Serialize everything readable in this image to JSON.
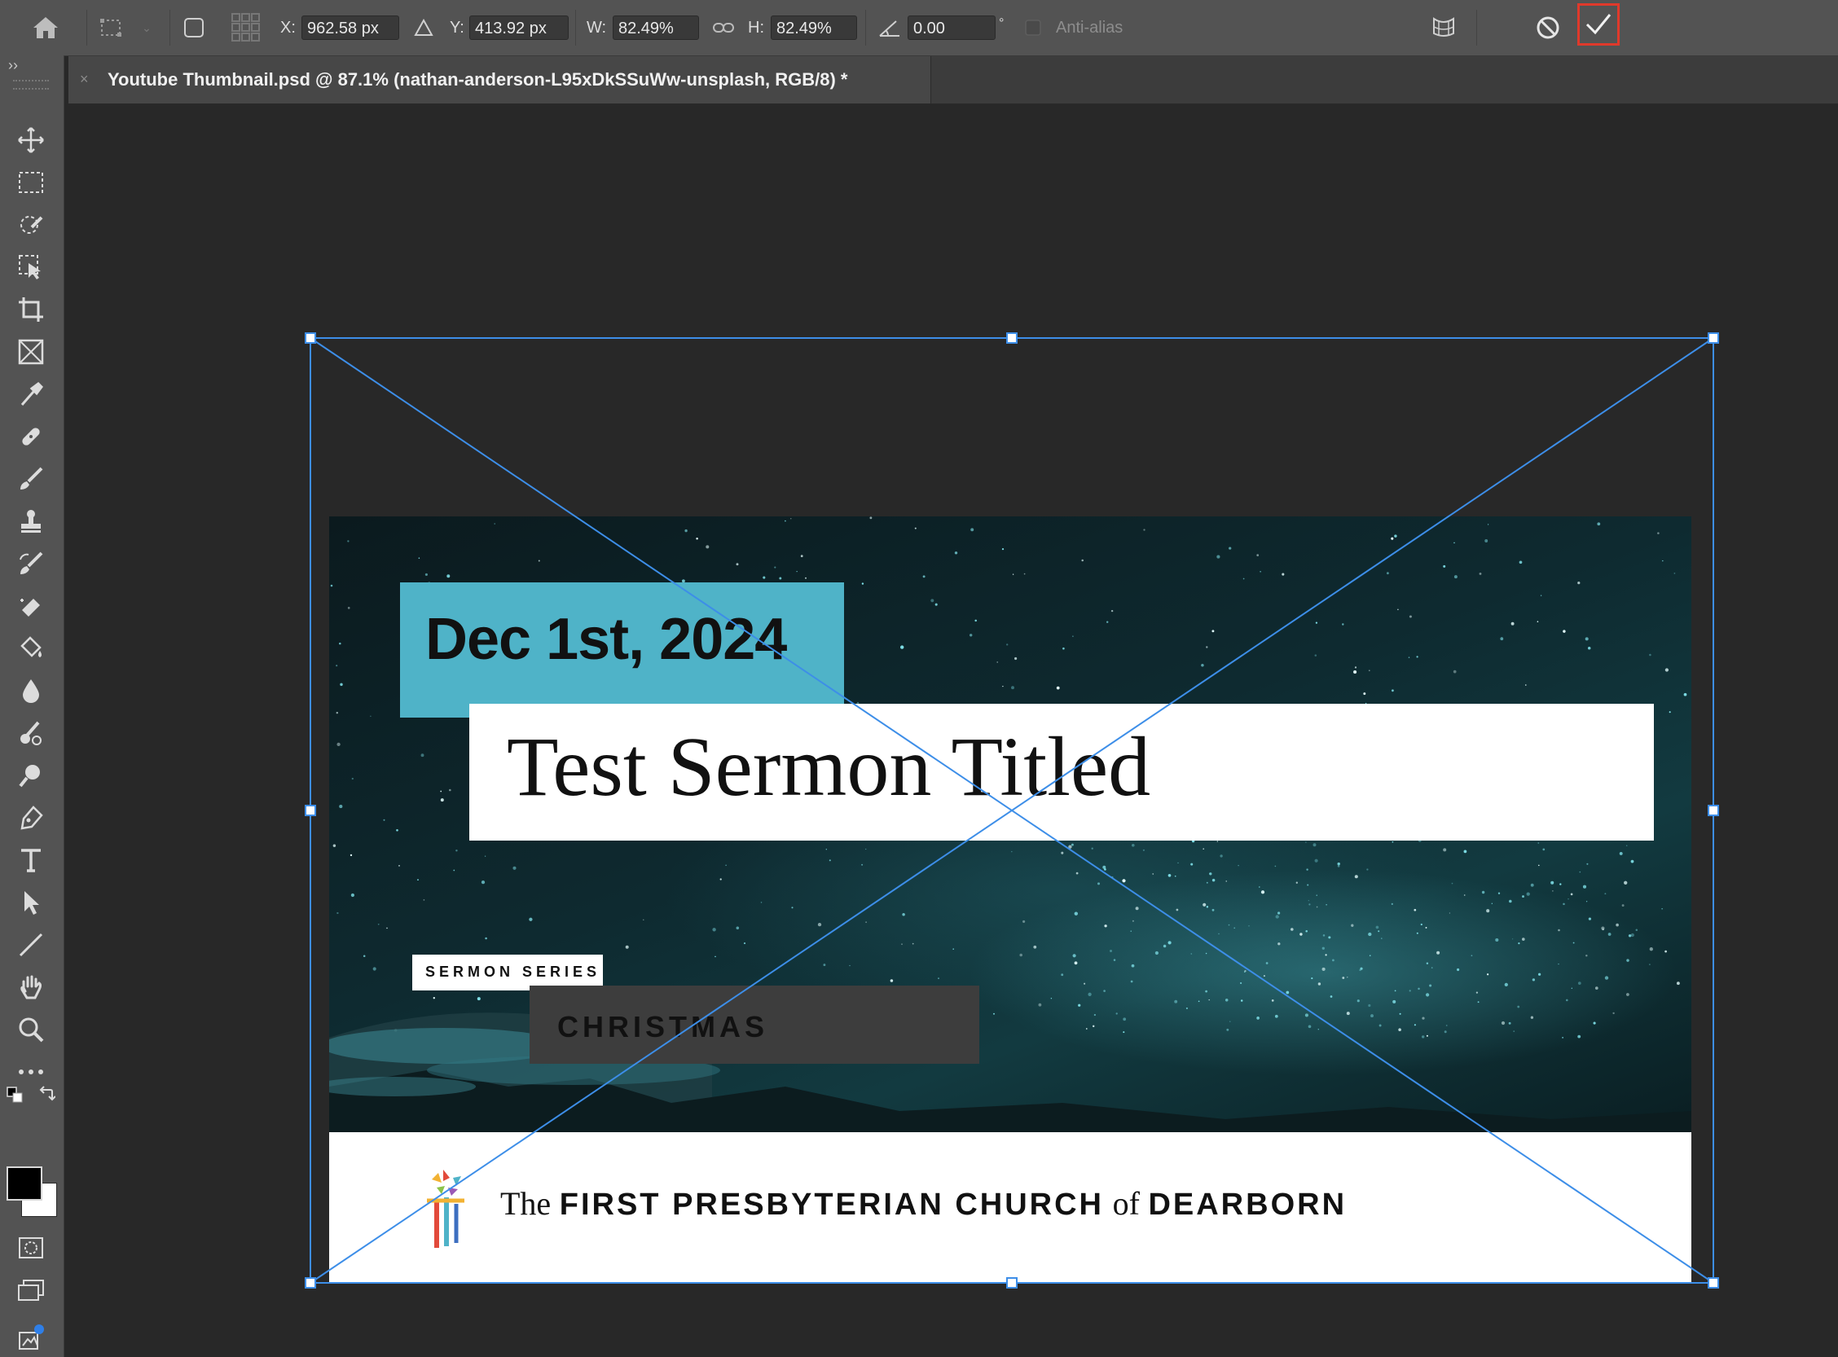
{
  "options_bar": {
    "x_label": "X:",
    "x_value": "962.58 px",
    "y_label": "Y:",
    "y_value": "413.92 px",
    "w_label": "W:",
    "w_value": "82.49%",
    "h_label": "H:",
    "h_value": "82.49%",
    "angle_value": "0.00",
    "angle_unit": "°",
    "antialias_label": "Anti-alias"
  },
  "toolbar": {
    "collapse_label": "››"
  },
  "document_tab": {
    "title": "Youtube Thumbnail.psd @ 87.1% (nathan-anderson-L95xDkSSuWw-unsplash, RGB/8) *",
    "close": "×"
  },
  "artwork": {
    "date": "Dec 1st, 2024",
    "title": "Test Sermon Titled",
    "series_label": "SERMON SERIES",
    "series_name": "CHRISTMAS",
    "church_the": "The",
    "church_name_1": "FIRST PRESBYTERIAN CHURCH",
    "church_of": "of",
    "church_name_2": "DEARBORN"
  },
  "colors": {
    "accent_teal": "#4fb3c8",
    "transform_blue": "#3d8ee8",
    "commit_highlight": "#e0392b"
  }
}
